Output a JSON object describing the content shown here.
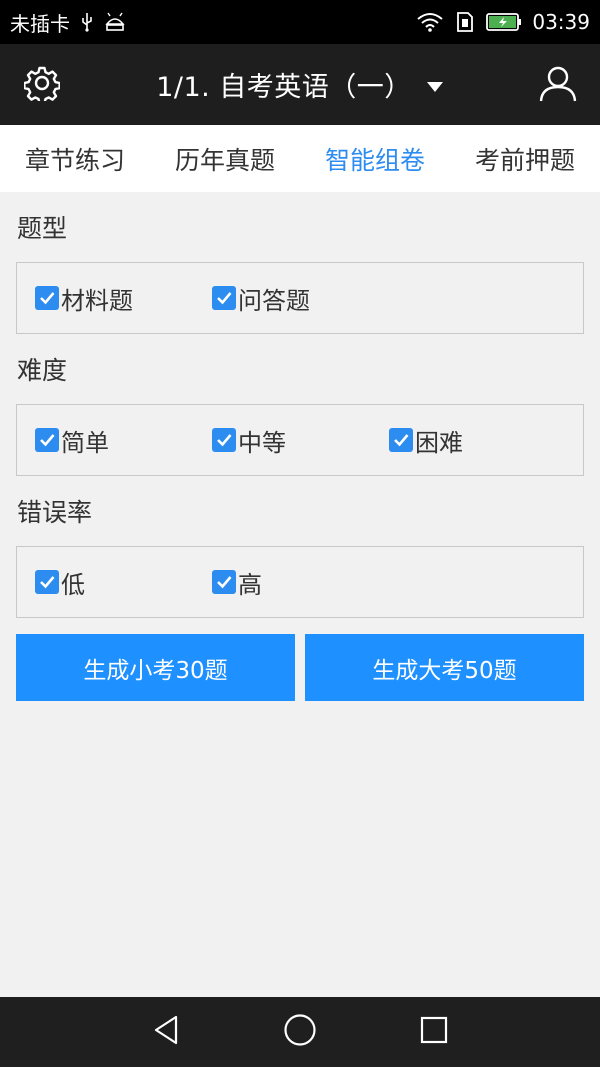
{
  "status_bar": {
    "carrier": "未插卡",
    "time": "03:39"
  },
  "header": {
    "title": "1/1. 自考英语（一）",
    "left_icon": "gear-icon",
    "right_icon": "user-icon"
  },
  "tabs": [
    {
      "label": "章节练习",
      "active": false
    },
    {
      "label": "历年真题",
      "active": false
    },
    {
      "label": "智能组卷",
      "active": true
    },
    {
      "label": "考前押题",
      "active": false
    }
  ],
  "sections": {
    "type": {
      "title": "题型",
      "options": [
        {
          "label": "材料题",
          "checked": true
        },
        {
          "label": "问答题",
          "checked": true
        }
      ]
    },
    "difficulty": {
      "title": "难度",
      "options": [
        {
          "label": "简单",
          "checked": true
        },
        {
          "label": "中等",
          "checked": true
        },
        {
          "label": "困难",
          "checked": true
        }
      ]
    },
    "error_rate": {
      "title": "错误率",
      "options": [
        {
          "label": "低",
          "checked": true
        },
        {
          "label": "高",
          "checked": true
        }
      ]
    }
  },
  "buttons": {
    "small_exam": "生成小考30题",
    "big_exam": "生成大考50题"
  },
  "colors": {
    "accent": "#2d8cf0",
    "button": "#1e90ff",
    "header_bg": "#1e1e1e"
  }
}
